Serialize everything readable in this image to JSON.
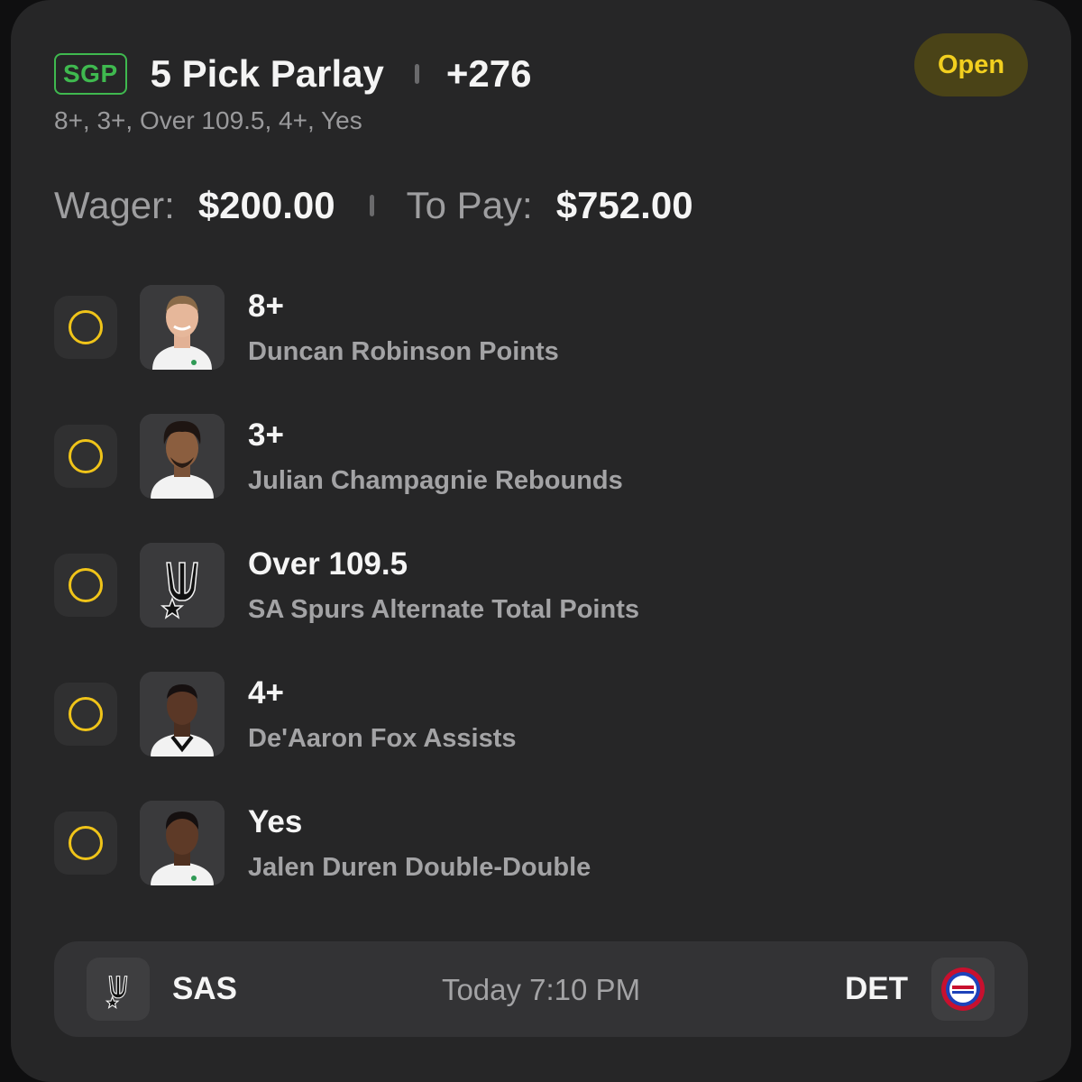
{
  "header": {
    "badge": "SGP",
    "title": "5 Pick Parlay",
    "odds": "+276",
    "subtitle": "8+, 3+, Over 109.5, 4+, Yes",
    "status": "Open"
  },
  "wager": {
    "wager_label": "Wager:",
    "wager_value": "$200.00",
    "pay_label": "To Pay:",
    "pay_value": "$752.00"
  },
  "picks": [
    {
      "line": "8+",
      "desc": "Duncan Robinson Points",
      "icon": "player-headshot-icon"
    },
    {
      "line": "3+",
      "desc": "Julian Champagnie Rebounds",
      "icon": "player-headshot-icon"
    },
    {
      "line": "Over 109.5",
      "desc": "SA Spurs Alternate Total Points",
      "icon": "spurs-logo-icon"
    },
    {
      "line": "4+",
      "desc": "De'Aaron Fox Assists",
      "icon": "player-headshot-icon"
    },
    {
      "line": "Yes",
      "desc": "Jalen Duren Double-Double",
      "icon": "player-headshot-icon"
    }
  ],
  "footer": {
    "away_team": "SAS",
    "time": "Today 7:10 PM",
    "home_team": "DET",
    "away_logo": "spurs-logo-icon",
    "home_logo": "pistons-logo-icon"
  },
  "colors": {
    "accent_yellow": "#f0c419",
    "sgp_green": "#3fb94f",
    "card_bg": "#262627",
    "pistons_blue": "#1d42ba",
    "pistons_red": "#c8102e"
  }
}
